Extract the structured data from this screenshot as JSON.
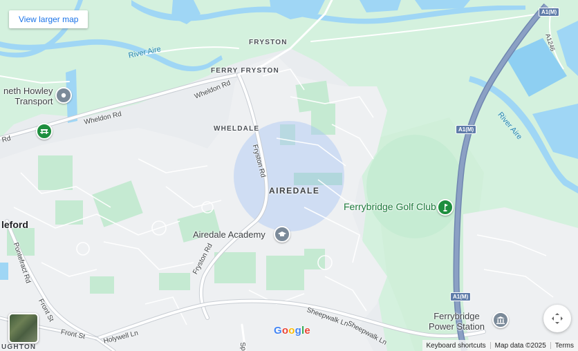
{
  "controls": {
    "larger_map": "View larger map",
    "fullscreen_icon": "fullscreen-icon",
    "map_type_icon": "satellite-thumbnail"
  },
  "places": {
    "fryston": "FRYSTON",
    "ferry_fryston": "FERRY FRYSTON",
    "wheldale": "WHELDALE",
    "airedale": "AIREDALE",
    "castleford": "leford",
    "houghton": "UGHTON"
  },
  "roads": {
    "wheldon_rd_1": "Wheldon Rd",
    "wheldon_rd_2": "Wheldon Rd",
    "rd_left": "Rd",
    "fryston_rd_1": "Fryston Rd",
    "fryston_rd_2": "Fryston Rd",
    "pontefract_rd": "Pontefract Rd",
    "front_st_1": "Front St",
    "front_st_2": "Front St",
    "holywell_ln": "Holywell Ln",
    "sheepwalk_ln_1": "Sheepwalk Ln",
    "sheepwalk_ln_2": "Sheepwalk Ln",
    "sp": "Sp",
    "a1m_1": "A1(M)",
    "a1m_2": "A1(M)",
    "a1m_3": "A1(M)",
    "a1246": "A1246"
  },
  "water": {
    "river_aire_1": "River Aire",
    "river_aire_2": "River Aire"
  },
  "pois": {
    "howley": [
      "neth Howley",
      "Transport"
    ],
    "academy": "Airedale Academy",
    "golf": "Ferrybridge Golf Club",
    "power": [
      "Ferrybridge",
      "Power Station"
    ]
  },
  "attribution": {
    "keyboard": "Keyboard shortcuts",
    "data": "Map data ©2025",
    "terms": "Terms"
  },
  "colors": {
    "land": "#e9ecef",
    "green": "#d4f1de",
    "park": "#b5e6c5",
    "water": "#9fd6f5",
    "motorway": "#8ba0c4",
    "highlight_circle": "#a9c5f5",
    "link": "#1a73e8"
  }
}
